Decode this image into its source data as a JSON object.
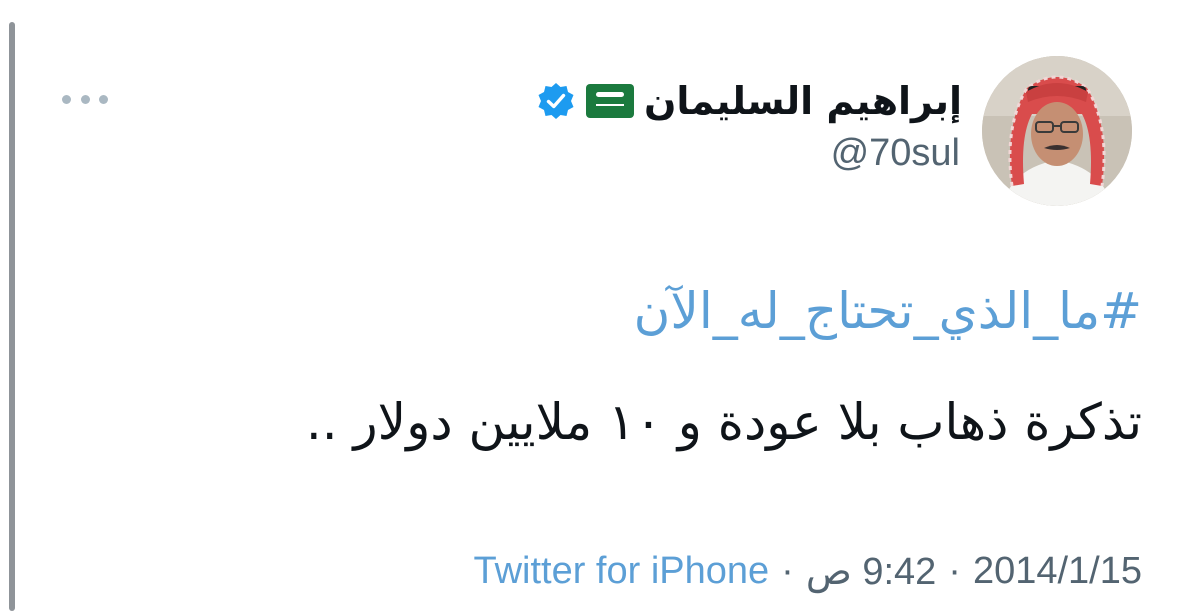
{
  "tweet": {
    "author": {
      "display_name": "إبراهيم السليمان",
      "flag_emoji": "flag-saudi-arabia-icon",
      "verified": true,
      "handle": "@70sul"
    },
    "hashtag": "#ما_الذي_تحتاج_له_الآن",
    "text": "تذكرة ذهاب بلا عودة و ١٠ ملايين دولار ..",
    "meta": {
      "source": "Twitter for iPhone",
      "separator": "·",
      "time": "9:42 ص",
      "date": "2014/1/15"
    }
  },
  "colors": {
    "link": "#5c9fd6",
    "verified": "#1d9bf0",
    "secondary_text": "#536471",
    "more_dots": "#aab8c2"
  }
}
